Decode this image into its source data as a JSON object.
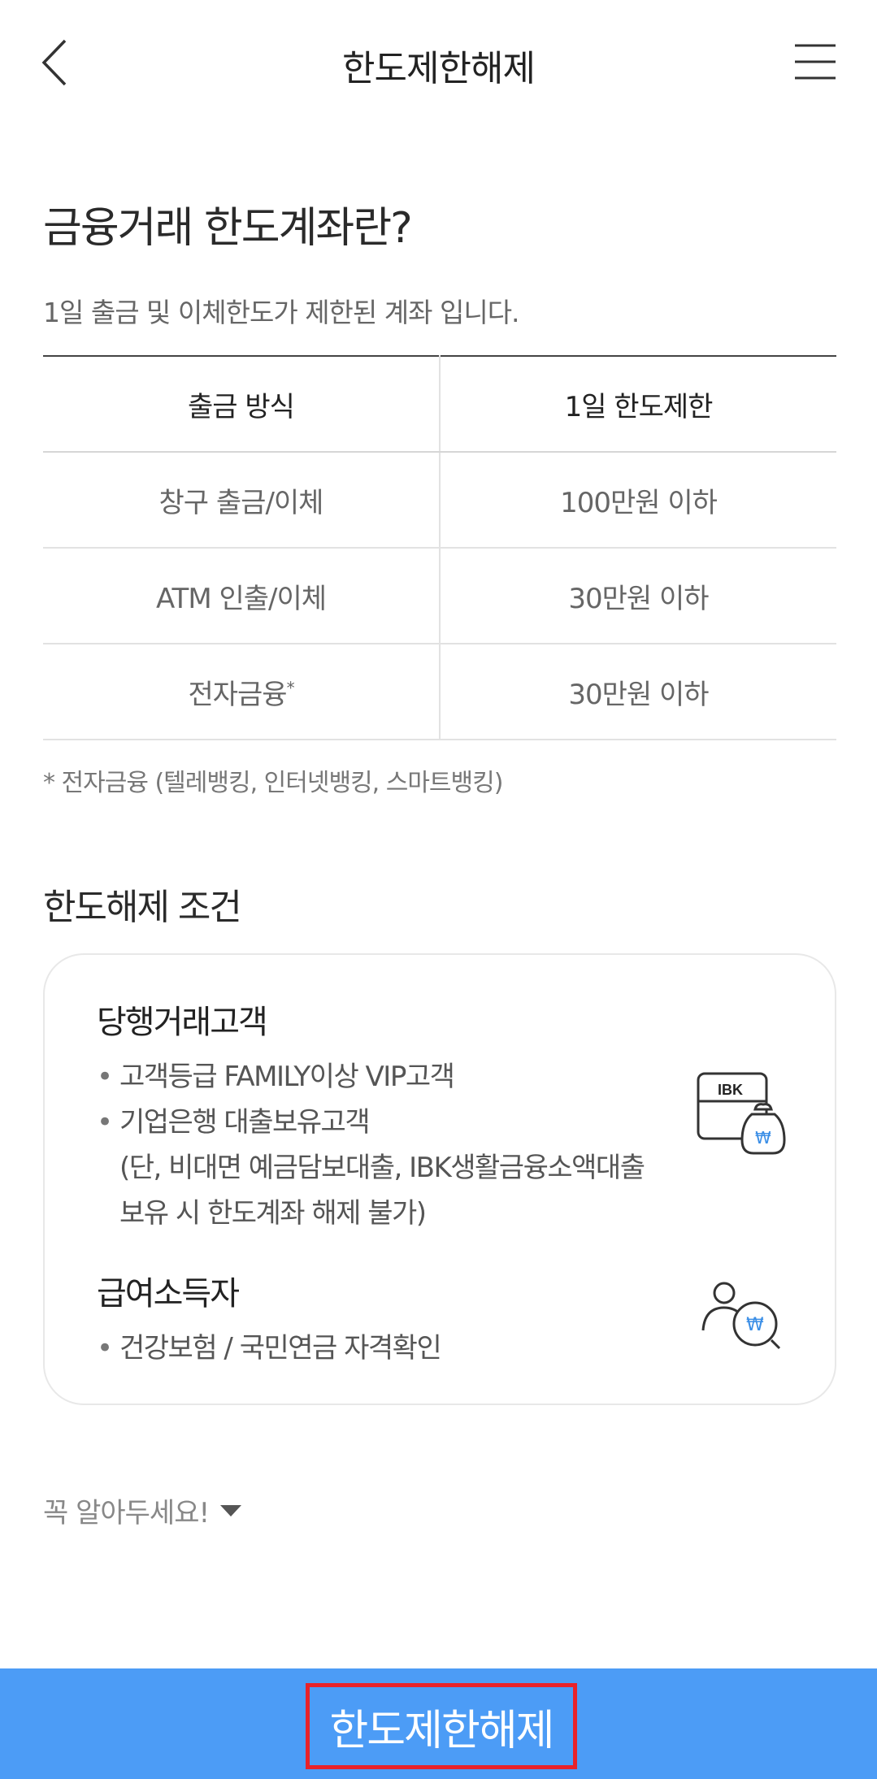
{
  "header": {
    "title": "한도제한해제",
    "back_icon": "chevron-left-icon",
    "menu_icon": "hamburger-menu-icon"
  },
  "intro": {
    "title": "금융거래 한도계좌란?",
    "description": "1일 출금 및 이체한도가 제한된 계좌 입니다."
  },
  "limit_table": {
    "headers": [
      "출금 방식",
      "1일 한도제한"
    ],
    "rows": [
      {
        "method": "창구 출금/이체",
        "limit": "100만원 이하"
      },
      {
        "method": "ATM 인출/이체",
        "limit": "30만원 이하"
      },
      {
        "method": "전자금융",
        "method_mark": "*",
        "limit": "30만원 이하"
      }
    ],
    "footnote": "* 전자금융 (텔레뱅킹, 인터넷뱅킹, 스마트뱅킹)"
  },
  "conditions": {
    "title": "한도해제 조건",
    "groups": [
      {
        "title": "당행거래고객",
        "bullets": [
          "고객등급 FAMILY이상 VIP고객",
          "기업은행 대출보유고객"
        ],
        "continuation": [
          "(단, 비대면 예금담보대출, IBK생활금융소액대출",
          "보유 시 한도계좌 해제 불가)"
        ],
        "icon": "ibk-card-moneybag-icon",
        "icon_text": "IBK",
        "icon_symbol": "₩"
      },
      {
        "title": "급여소득자",
        "bullets": [
          "건강보험 / 국민연금 자격확인"
        ],
        "icon": "person-won-search-icon",
        "icon_symbol": "₩"
      }
    ]
  },
  "notice": {
    "label": "꼭 알아두세요!"
  },
  "cta": {
    "label": "한도제한해제"
  },
  "colors": {
    "accent": "#4c9cf6",
    "highlight_border": "#e8222a",
    "icon_blue": "#3a8ee6"
  }
}
